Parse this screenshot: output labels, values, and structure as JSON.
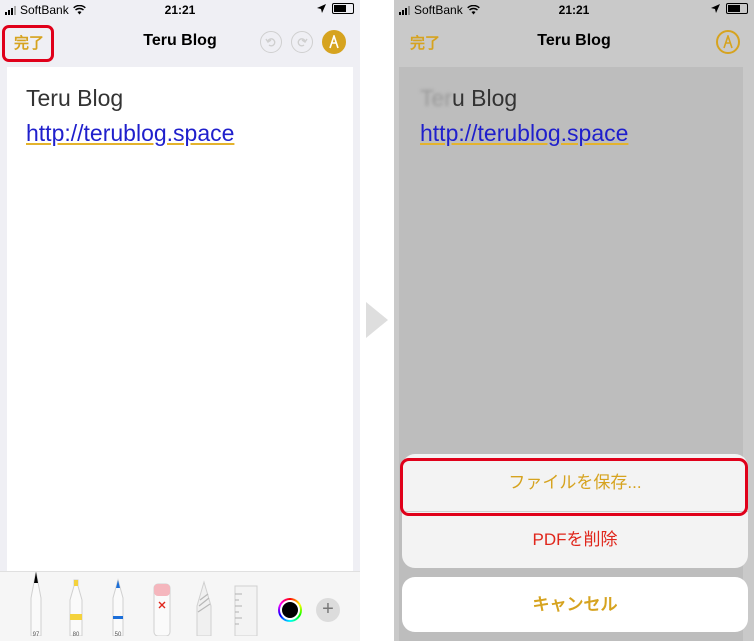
{
  "left": {
    "status": {
      "carrier": "SoftBank",
      "time": "21:21"
    },
    "nav": {
      "done_label": "完了",
      "title": "Teru Blog"
    },
    "doc": {
      "title": "Teru Blog",
      "link": "http://terublog.space"
    },
    "tools": [
      {
        "name": "pen",
        "number": "97"
      },
      {
        "name": "marker",
        "number": "80"
      },
      {
        "name": "pencil",
        "number": "50"
      },
      {
        "name": "eraser",
        "number": ""
      },
      {
        "name": "lasso",
        "number": ""
      },
      {
        "name": "ruler",
        "number": ""
      }
    ],
    "plus_label": "+",
    "colors": {
      "accent": "#d6a31f",
      "link": "#1f1fcc",
      "highlight": "#e0001a"
    }
  },
  "right": {
    "status": {
      "carrier": "SoftBank",
      "time": "21:21"
    },
    "nav": {
      "done_label": "完了",
      "title": "Teru Blog"
    },
    "doc": {
      "title_blurred": "Ter",
      "title_rest": "u Blog",
      "link": "http://terublog.space"
    },
    "sheet": {
      "save_label": "ファイルを保存...",
      "delete_label": "PDFを削除",
      "cancel_label": "キャンセル"
    },
    "colors": {
      "delete": "#e0261b"
    }
  }
}
